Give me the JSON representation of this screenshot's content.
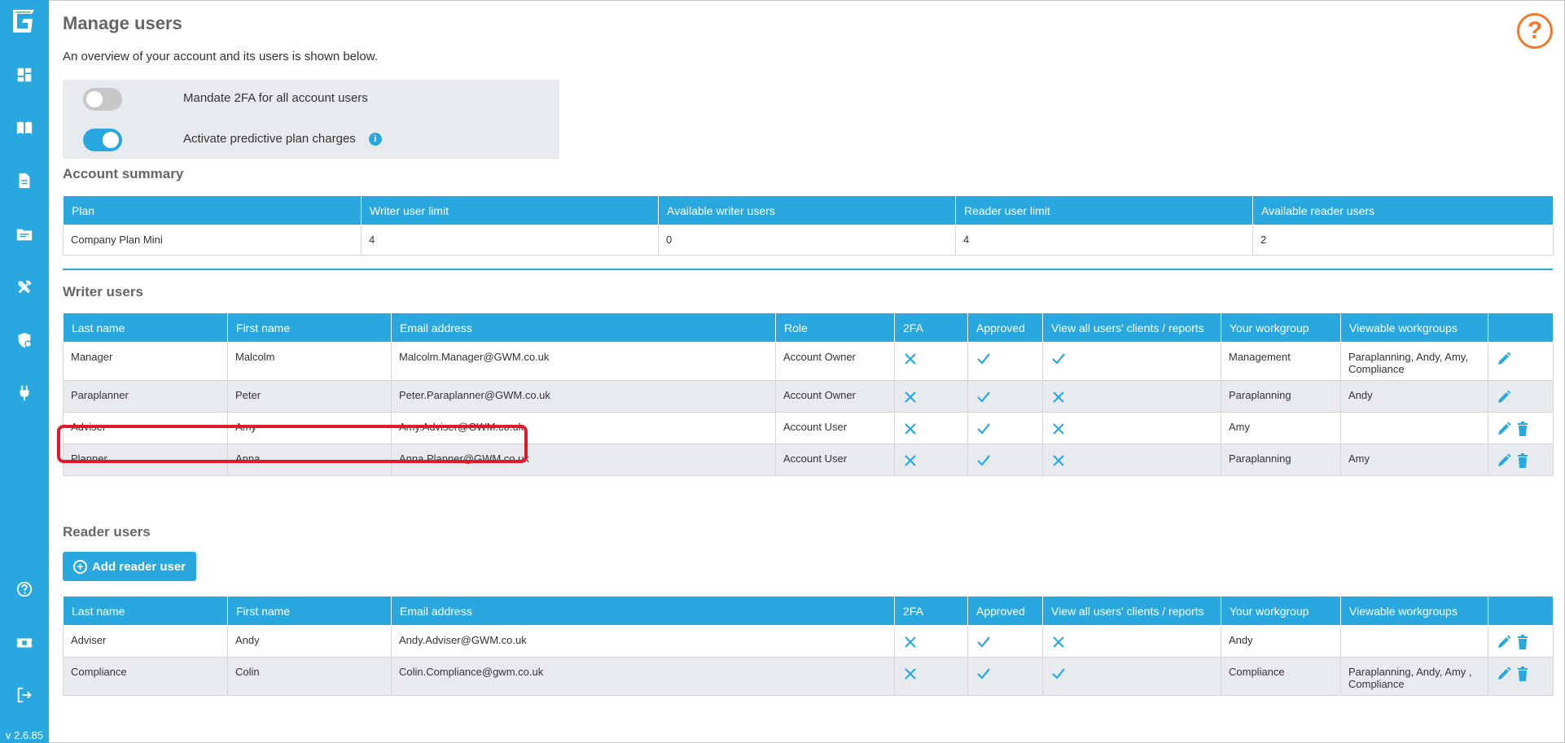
{
  "app": {
    "version": "v 2.6.85"
  },
  "colors": {
    "accent": "#29a8e0",
    "help": "#f07a2a",
    "highlight": "#e2182b",
    "row_alt": "#e8ebee"
  },
  "sidebar": {
    "top_icons": [
      "dashboard-icon",
      "book-icon",
      "document-icon",
      "folder-icon",
      "tools-icon",
      "shield-icon",
      "plug-icon"
    ],
    "bottom_icons": [
      "help-icon",
      "ticket-icon",
      "logout-icon"
    ]
  },
  "header": {
    "title": "Manage users",
    "subtitle": "An overview of your account and its users is shown below."
  },
  "settings": {
    "mandate_2fa": {
      "label": "Mandate 2FA for all account users",
      "on": false
    },
    "predictive_charges": {
      "label": "Activate predictive plan charges",
      "on": true,
      "info": "i"
    }
  },
  "account_summary": {
    "title": "Account summary",
    "headers": [
      "Plan",
      "Writer user limit",
      "Available writer users",
      "Reader user limit",
      "Available reader users"
    ],
    "row": [
      "Company Plan Mini",
      "4",
      "0",
      "4",
      "2"
    ]
  },
  "writer_users": {
    "title": "Writer users",
    "headers": [
      "Last name",
      "First name",
      "Email address",
      "Role",
      "2FA",
      "Approved",
      "View all users' clients / reports",
      "Your workgroup",
      "Viewable workgroups",
      ""
    ],
    "rows": [
      {
        "last": "Manager",
        "first": "Malcolm",
        "email": "Malcolm.Manager@GWM.co.uk",
        "role": "Account Owner",
        "twofa": false,
        "approved": true,
        "view_all": true,
        "workgroup": "Management",
        "viewable": "Paraplanning, Andy, Amy, Compliance",
        "can_delete": false
      },
      {
        "last": "Paraplanner",
        "first": "Peter",
        "email": "Peter.Paraplanner@GWM.co.uk",
        "role": "Account Owner",
        "twofa": false,
        "approved": true,
        "view_all": false,
        "workgroup": "Paraplanning",
        "viewable": "Andy",
        "can_delete": false
      },
      {
        "last": "Adviser",
        "first": "Amy",
        "email": "Amy.Adviser@GWM.co.uk",
        "role": "Account User",
        "twofa": false,
        "approved": true,
        "view_all": false,
        "workgroup": "Amy",
        "viewable": "",
        "can_delete": true
      },
      {
        "last": "Planner",
        "first": "Anna",
        "email": "Anna.Planner@GWM.co.uk",
        "role": "Account User",
        "twofa": false,
        "approved": true,
        "view_all": false,
        "workgroup": "Paraplanning",
        "viewable": "Amy",
        "can_delete": true
      }
    ]
  },
  "reader_users": {
    "title": "Reader users",
    "add_button": "Add reader user",
    "headers": [
      "Last name",
      "First name",
      "Email address",
      "2FA",
      "Approved",
      "View all users' clients / reports",
      "Your workgroup",
      "Viewable workgroups",
      ""
    ],
    "rows": [
      {
        "last": "Adviser",
        "first": "Andy",
        "email": "Andy.Adviser@GWM.co.uk",
        "twofa": false,
        "approved": true,
        "view_all": false,
        "workgroup": "Andy",
        "viewable": ""
      },
      {
        "last": "Compliance",
        "first": "Colin",
        "email": "Colin.Compliance@gwm.co.uk",
        "twofa": false,
        "approved": true,
        "view_all": true,
        "workgroup": "Compliance",
        "viewable": "Paraplanning, Andy, Amy , Compliance"
      }
    ]
  }
}
